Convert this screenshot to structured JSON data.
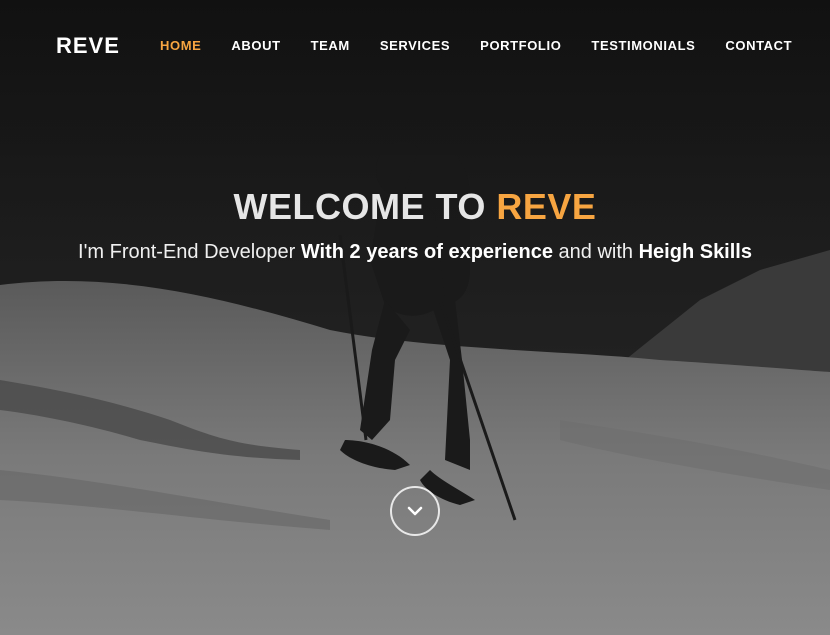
{
  "brand": {
    "name": "REVE"
  },
  "nav": {
    "items": [
      {
        "label": "HOME",
        "active": true
      },
      {
        "label": "ABOUT"
      },
      {
        "label": "TEAM"
      },
      {
        "label": "SERVICES"
      },
      {
        "label": "PORTFOLIO"
      },
      {
        "label": "TESTIMONIALS"
      },
      {
        "label": "CONTACT"
      }
    ]
  },
  "hero": {
    "title_prefix": "WELCOME TO",
    "title_accent": "REVE",
    "subtitle_part1": "I'm Front-End Developer",
    "subtitle_bold1": "With 2 years of experience",
    "subtitle_part2": "and with",
    "subtitle_bold2": "Heigh Skills",
    "scroll_icon": "chevron-down-icon"
  },
  "colors": {
    "accent": "#f7a541",
    "text": "#ffffff"
  }
}
